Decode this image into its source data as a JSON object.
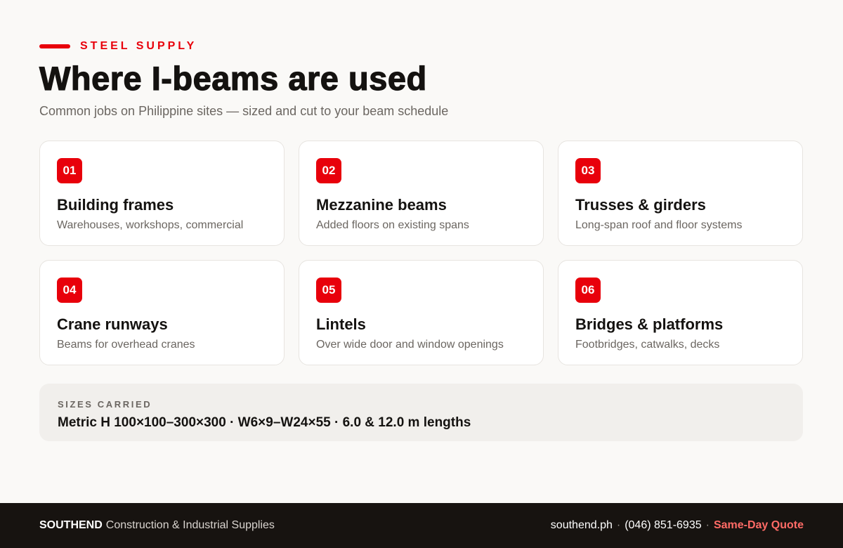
{
  "header": {
    "eyebrow": "STEEL SUPPLY",
    "title": "Where I-beams are used",
    "subtitle": "Common jobs on Philippine sites — sized and cut to your beam schedule"
  },
  "cards": [
    {
      "number": "01",
      "title": "Building frames",
      "description": "Warehouses, workshops, commercial"
    },
    {
      "number": "02",
      "title": "Mezzanine beams",
      "description": "Added floors on existing spans"
    },
    {
      "number": "03",
      "title": "Trusses & girders",
      "description": "Long-span roof and floor systems"
    },
    {
      "number": "04",
      "title": "Crane runways",
      "description": "Beams for overhead cranes"
    },
    {
      "number": "05",
      "title": "Lintels",
      "description": "Over wide door and window openings"
    },
    {
      "number": "06",
      "title": "Bridges & platforms",
      "description": "Footbridges, catwalks, decks"
    }
  ],
  "sizes": {
    "label": "SIZES CARRIED",
    "value": "Metric H 100×100–300×300 · W6×9–W24×55 · 6.0 & 12.0 m lengths"
  },
  "footer": {
    "brand": "SOUTHEND",
    "brand_sub": "Construction & Industrial Supplies",
    "website": "southend.ph",
    "separator": "·",
    "phone": "(046) 851-6935",
    "cta": "Same-Day Quote"
  },
  "colors": {
    "accent": "#e8000b",
    "background": "#faf9f7",
    "footer_bg": "#171310",
    "cta": "#ff6b66"
  }
}
